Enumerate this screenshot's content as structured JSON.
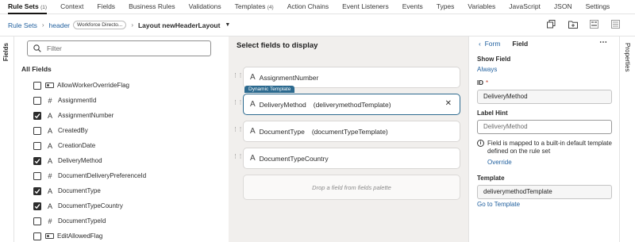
{
  "tabs": [
    {
      "label": "Rule Sets",
      "count": "(1)",
      "active": true
    },
    {
      "label": "Context"
    },
    {
      "label": "Fields"
    },
    {
      "label": "Business Rules"
    },
    {
      "label": "Validations"
    },
    {
      "label": "Templates",
      "count": "(4)"
    },
    {
      "label": "Action Chains"
    },
    {
      "label": "Event Listeners"
    },
    {
      "label": "Events"
    },
    {
      "label": "Types"
    },
    {
      "label": "Variables"
    },
    {
      "label": "JavaScript"
    },
    {
      "label": "JSON"
    },
    {
      "label": "Settings"
    }
  ],
  "breadcrumb": {
    "rule_sets": "Rule Sets",
    "header": "header",
    "badge": "Workforce Directo...",
    "layout": "Layout newHeaderLayout"
  },
  "left_tab": "Fields",
  "right_tab": "Properties",
  "left_panel": {
    "filter_placeholder": "Filter",
    "all_fields": "All Fields",
    "fields": [
      {
        "name": "AllowWorkerOverrideFlag",
        "type": "boolean",
        "checked": false
      },
      {
        "name": "AssignmentId",
        "type": "number",
        "checked": false
      },
      {
        "name": "AssignmentNumber",
        "type": "text",
        "checked": true
      },
      {
        "name": "CreatedBy",
        "type": "text",
        "checked": false
      },
      {
        "name": "CreationDate",
        "type": "text",
        "checked": false
      },
      {
        "name": "DeliveryMethod",
        "type": "text",
        "checked": true
      },
      {
        "name": "DocumentDeliveryPreferenceId",
        "type": "number",
        "checked": false
      },
      {
        "name": "DocumentType",
        "type": "text",
        "checked": true
      },
      {
        "name": "DocumentTypeCountry",
        "type": "text",
        "checked": true
      },
      {
        "name": "DocumentTypeId",
        "type": "number",
        "checked": false
      },
      {
        "name": "EditAllowedFlag",
        "type": "boolean",
        "checked": false
      }
    ]
  },
  "canvas": {
    "title": "Select fields to display",
    "dynamic_tag": "Dynamic Template",
    "slots": [
      {
        "name": "AssignmentNumber",
        "template": ""
      },
      {
        "name": "DeliveryMethod",
        "template": "(deliverymethodTemplate)",
        "selected": true
      },
      {
        "name": "DocumentType",
        "template": "(documentTypeTemplate)"
      },
      {
        "name": "DocumentTypeCountry",
        "template": ""
      }
    ],
    "drop_text": "Drop a field from fields palette"
  },
  "properties": {
    "back_label": "Form",
    "title": "Field",
    "show_field_label": "Show Field",
    "show_field_value": "Always",
    "id_label": "ID",
    "id_value": "DeliveryMethod",
    "label_hint_label": "Label Hint",
    "label_hint_placeholder": "DeliveryMethod",
    "info_text": "Field is mapped to a built-in default template defined on the rule set",
    "override_link": "Override",
    "template_label": "Template",
    "template_value": "deliverymethodTemplate",
    "goto_template": "Go to Template"
  }
}
